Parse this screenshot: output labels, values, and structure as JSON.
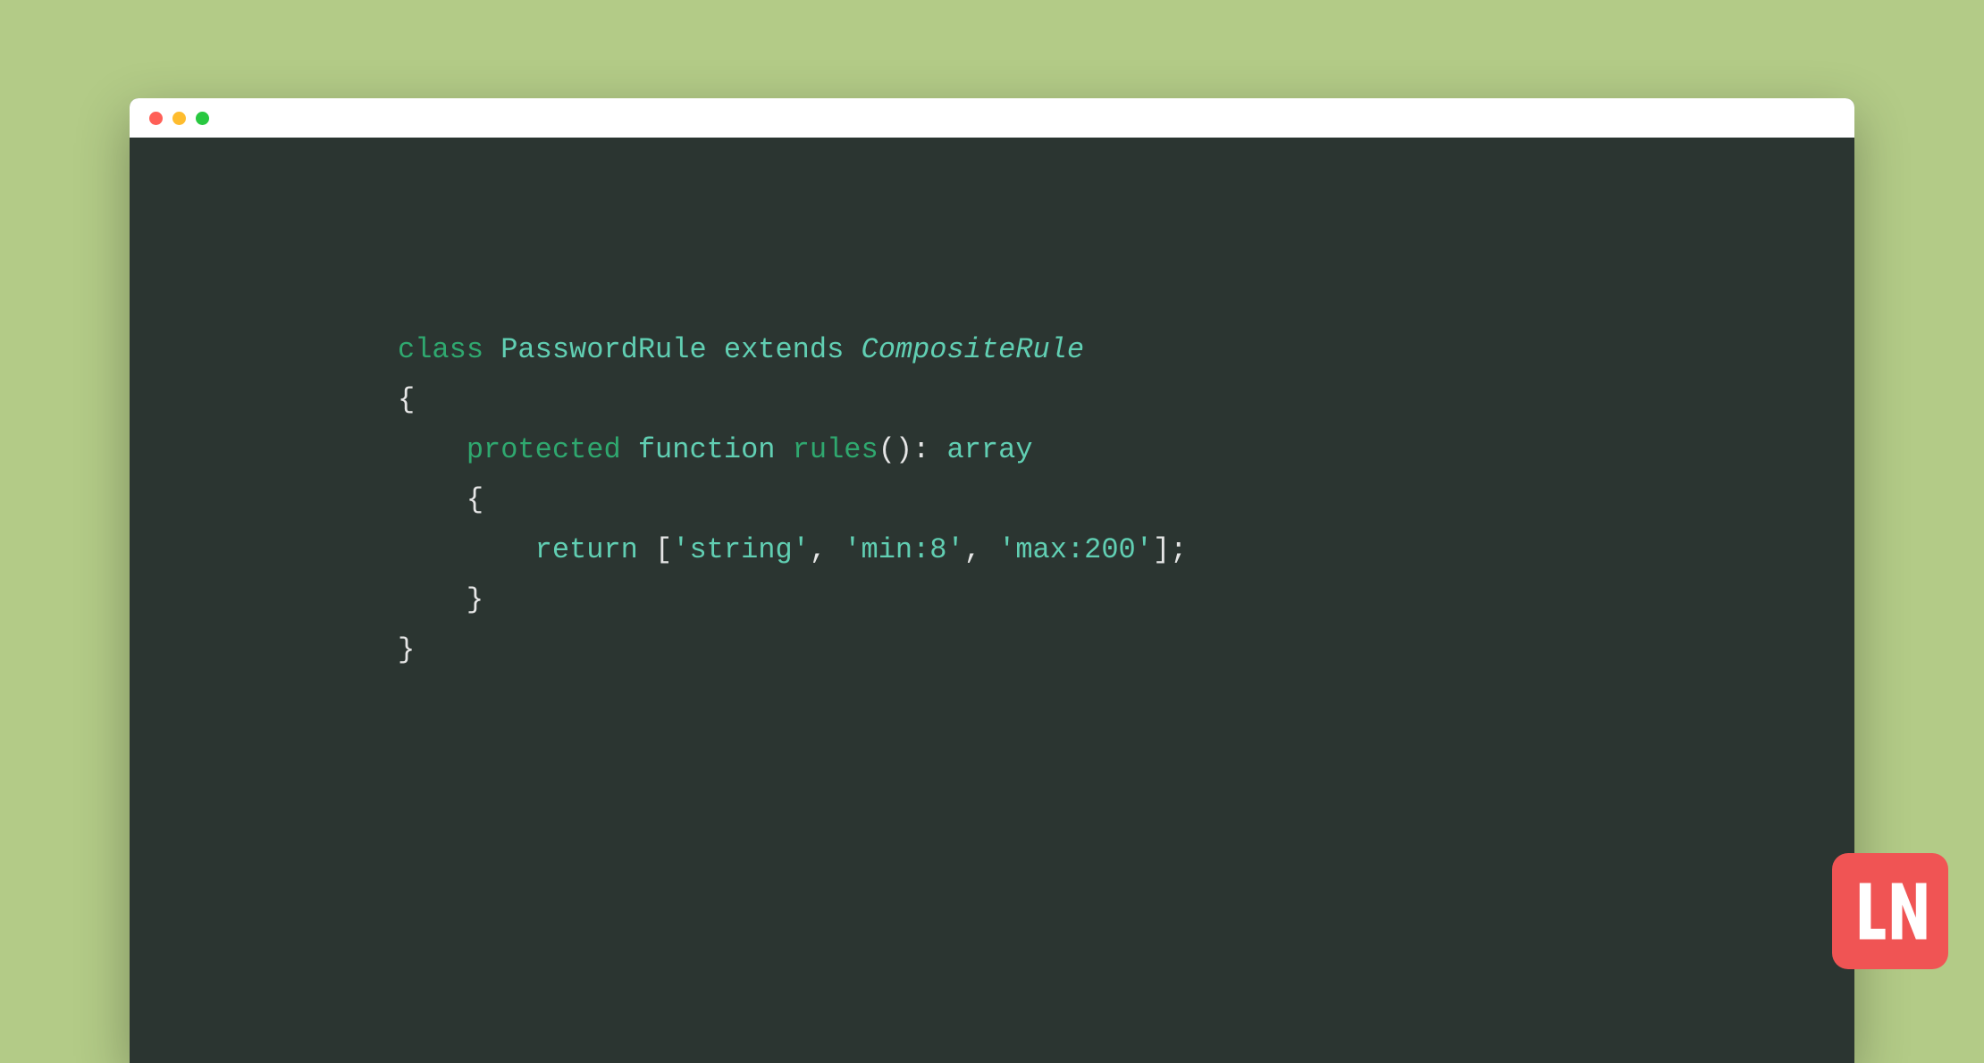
{
  "colors": {
    "background": "#b3cb87",
    "editor_bg": "#2b3531",
    "titlebar_bg": "#ffffff",
    "logo_bg": "#f05454"
  },
  "window": {
    "traffic_lights": [
      "close",
      "minimize",
      "maximize"
    ]
  },
  "code": {
    "line1": {
      "keyword_class": "class",
      "class_name": "PasswordRule",
      "keyword_extends": "extends",
      "parent_class": "CompositeRule"
    },
    "line2": {
      "brace": "{"
    },
    "line3": {
      "keyword_protected": "protected",
      "keyword_function": "function",
      "method_name": "rules",
      "parens": "()",
      "colon": ":",
      "return_type": "array"
    },
    "line4": {
      "brace": "{"
    },
    "line5": {
      "keyword_return": "return",
      "bracket_open": "[",
      "string1": "'string'",
      "comma1": ",",
      "string2": "'min:8'",
      "comma2": ",",
      "string3": "'max:200'",
      "bracket_close": "]",
      "semicolon": ";"
    },
    "line6": {
      "brace": "}"
    },
    "line7": {
      "brace": "}"
    }
  },
  "logo": {
    "text": "LN"
  }
}
